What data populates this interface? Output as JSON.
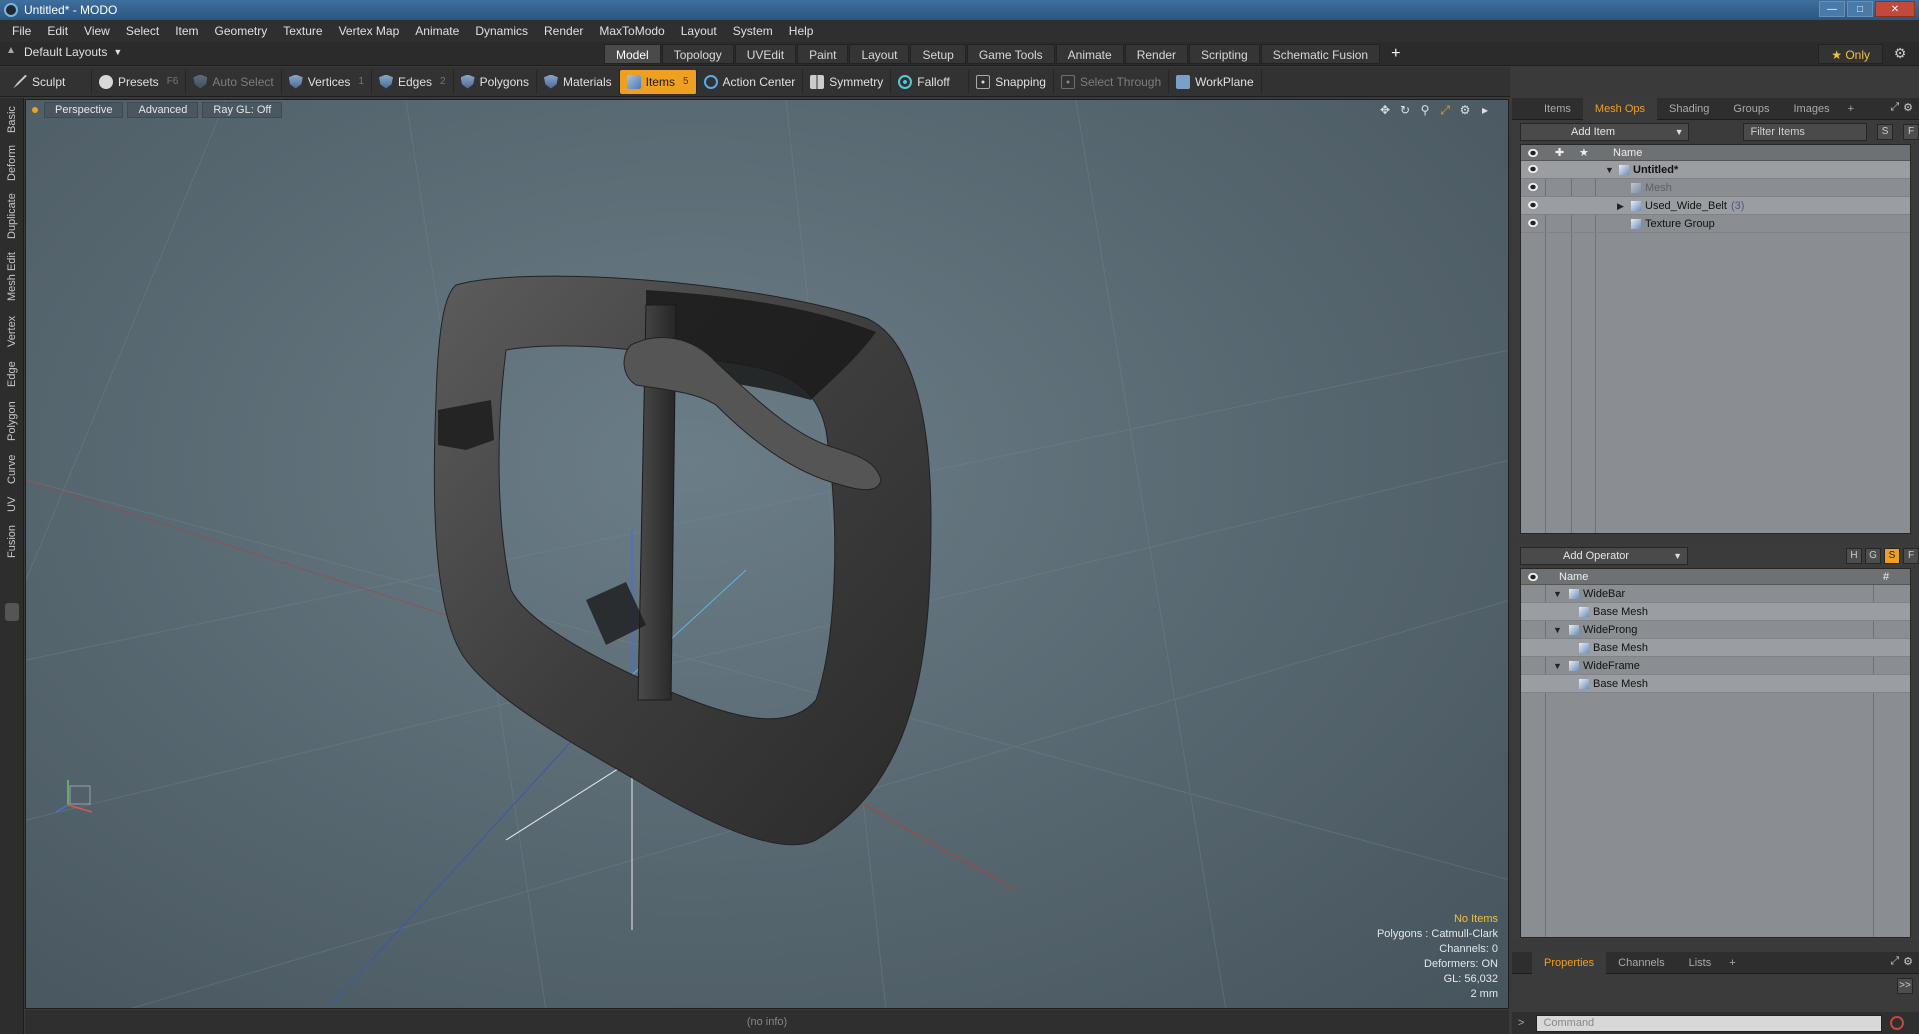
{
  "window": {
    "title": "Untitled* - MODO"
  },
  "menu": [
    "File",
    "Edit",
    "View",
    "Select",
    "Item",
    "Geometry",
    "Texture",
    "Vertex Map",
    "Animate",
    "Dynamics",
    "Render",
    "MaxToModo",
    "Layout",
    "System",
    "Help"
  ],
  "layout": {
    "selector": "Default Layouts",
    "tabs": [
      "Model",
      "Topology",
      "UVEdit",
      "Paint",
      "Layout",
      "Setup",
      "Game Tools",
      "Animate",
      "Render",
      "Scripting",
      "Schematic Fusion"
    ],
    "active_tab": "Model",
    "only_label": "Only"
  },
  "toolbar": {
    "sculpt": "Sculpt",
    "presets": "Presets",
    "presets_key": "F6",
    "auto_select": "Auto Select",
    "vertices": "Vertices",
    "vertices_key": "1",
    "edges": "Edges",
    "edges_key": "2",
    "polygons": "Polygons",
    "materials": "Materials",
    "items": "Items",
    "items_key": "5",
    "action_center": "Action Center",
    "symmetry": "Symmetry",
    "falloff": "Falloff",
    "snapping": "Snapping",
    "select_through": "Select Through",
    "workplane": "WorkPlane"
  },
  "left_tabs": [
    "Basic",
    "Deform",
    "Duplicate",
    "Mesh Edit",
    "Vertex",
    "Edge",
    "Polygon",
    "Curve",
    "UV",
    "Fusion"
  ],
  "viewport": {
    "view": "Perspective",
    "mode": "Advanced",
    "raygl": "Ray GL: Off",
    "info": {
      "no_items": "No Items",
      "polygons": "Polygons : Catmull-Clark",
      "channels": "Channels: 0",
      "deformers": "Deformers: ON",
      "gl": "GL: 56,032",
      "scale": "2 mm"
    }
  },
  "status": "(no info)",
  "items_panel": {
    "tabs": [
      "Items",
      "Mesh Ops",
      "Shading",
      "Groups",
      "Images"
    ],
    "active_tab": "Mesh Ops",
    "add_item": "Add Item",
    "filter_placeholder": "Filter Items",
    "s_btn": "S",
    "f_btn": "F",
    "col_name": "Name",
    "tree": [
      {
        "label": "Untitled*",
        "count": ""
      },
      {
        "label": "Mesh",
        "count": ""
      },
      {
        "label": "Used_Wide_Belt",
        "count": "(3)"
      },
      {
        "label": "Texture Group",
        "count": ""
      }
    ]
  },
  "meshops_panel": {
    "add_operator": "Add Operator",
    "h_btn": "H",
    "g_btn": "G",
    "s_btn": "S",
    "f_btn": "F",
    "col_name": "Name",
    "col_hash": "#",
    "ops": [
      {
        "label": "WideBar"
      },
      {
        "label": "Base Mesh"
      },
      {
        "label": "WideProng"
      },
      {
        "label": "Base Mesh"
      },
      {
        "label": "WideFrame"
      },
      {
        "label": "Base Mesh"
      }
    ]
  },
  "props_panel": {
    "tabs": [
      "Properties",
      "Channels",
      "Lists"
    ],
    "active_tab": "Properties",
    "expand": ">>"
  },
  "command": {
    "placeholder": "Command"
  }
}
